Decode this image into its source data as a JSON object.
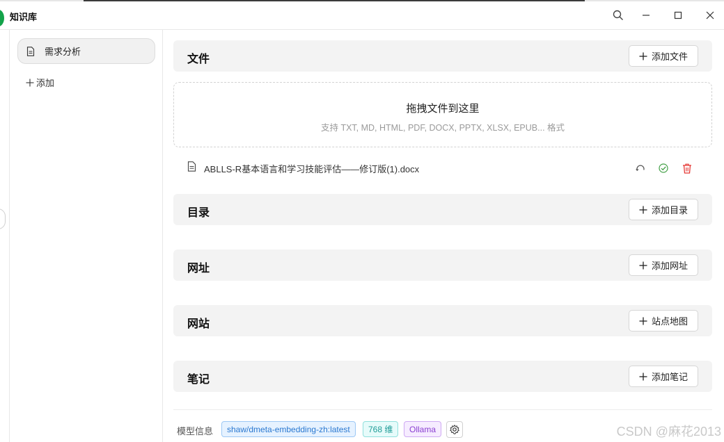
{
  "window": {
    "title": "知识库"
  },
  "sidebar": {
    "items": [
      {
        "label": "需求分析",
        "icon": "file-icon"
      }
    ],
    "add_label": "添加"
  },
  "sections": {
    "files": {
      "title": "文件",
      "button": "添加文件"
    },
    "directory": {
      "title": "目录",
      "button": "添加目录"
    },
    "urls": {
      "title": "网址",
      "button": "添加网址"
    },
    "website": {
      "title": "网站",
      "button": "站点地图"
    },
    "notes": {
      "title": "笔记",
      "button": "添加笔记"
    }
  },
  "dropzone": {
    "title": "拖拽文件到这里",
    "subtitle": "支持 TXT, MD, HTML, PDF, DOCX, PPTX, XLSX, EPUB... 格式"
  },
  "files": [
    {
      "name": "ABLLS-R基本语言和学习技能评估——修订版(1).docx",
      "status": "done"
    }
  ],
  "model_info": {
    "label": "模型信息",
    "model": "shaw/dmeta-embedding-zh:latest",
    "dimensions": "768 维",
    "provider": "Ollama"
  },
  "watermark": "CSDN @麻花2013",
  "colors": {
    "accent_green": "#13a34a",
    "delete_red": "#e53935",
    "success_green": "#43a047"
  }
}
